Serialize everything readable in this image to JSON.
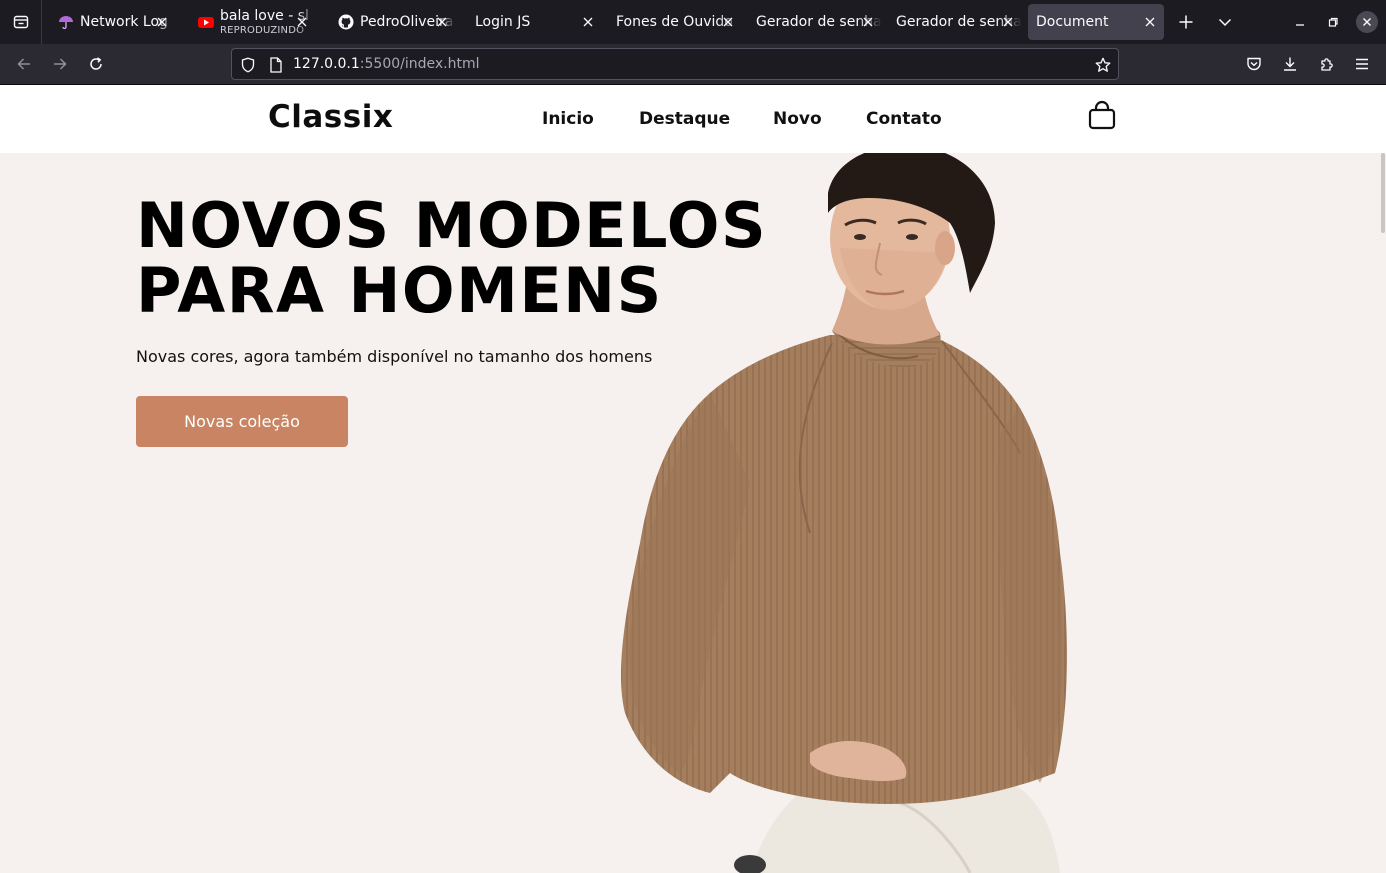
{
  "browser": {
    "tabs": [
      {
        "title": "Network Log",
        "icon": "umbrella-icon"
      },
      {
        "title": "bala love - sl",
        "subtitle": "REPRODUZINDO",
        "icon": "youtube-icon"
      },
      {
        "title": "PedroOliveira",
        "icon": "github-icon"
      },
      {
        "title": "Login JS",
        "icon": ""
      },
      {
        "title": "Fones de Ouvido",
        "icon": ""
      },
      {
        "title": "Gerador de senha",
        "icon": ""
      },
      {
        "title": "Gerador de senha",
        "icon": ""
      },
      {
        "title": "Document",
        "icon": "",
        "active": true
      }
    ],
    "url_host": "127.0.0.1",
    "url_rest": ":5500/index.html"
  },
  "site": {
    "logo": "Classix",
    "nav": [
      "Inicio",
      "Destaque",
      "Novo",
      "Contato"
    ],
    "cart_icon": "shopping-bag-icon"
  },
  "hero": {
    "title_line1": "NOVOS MODELOS",
    "title_line2": "PARA HOMENS",
    "subtitle": "Novas cores, agora também disponível no tamanho dos homens",
    "button": "Novas coleção"
  },
  "colors": {
    "page_bg": "#f6f1ee",
    "button_bg": "#c98563",
    "sweater": "#a57e5e"
  }
}
